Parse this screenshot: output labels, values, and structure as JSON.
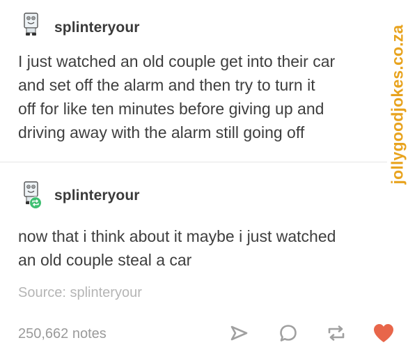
{
  "post": {
    "username": "splinteryour",
    "text_lines": [
      "I just watched an old couple get into their car",
      "and set off the alarm and then try to turn it",
      "off for like ten minutes before giving up and",
      "driving away with the alarm still going off"
    ]
  },
  "reblog": {
    "username": "splinteryour",
    "text_lines": [
      "now that i think about it maybe i just watched",
      "an old couple steal a car"
    ]
  },
  "footer": {
    "source": "Source: splinteryour",
    "notes": "250,662 notes",
    "actions": {
      "share_icon": "send-icon",
      "reply_icon": "reply-bubble-icon",
      "reblog_icon": "reblog-icon",
      "like_icon": "heart-icon"
    },
    "like_color": "#e8664a",
    "icon_color": "#a0a0a0",
    "reblog_badge_color": "#3fbf72"
  },
  "watermark": "jollygoodjokes.co.za",
  "watermark_color": "#e8a31e"
}
